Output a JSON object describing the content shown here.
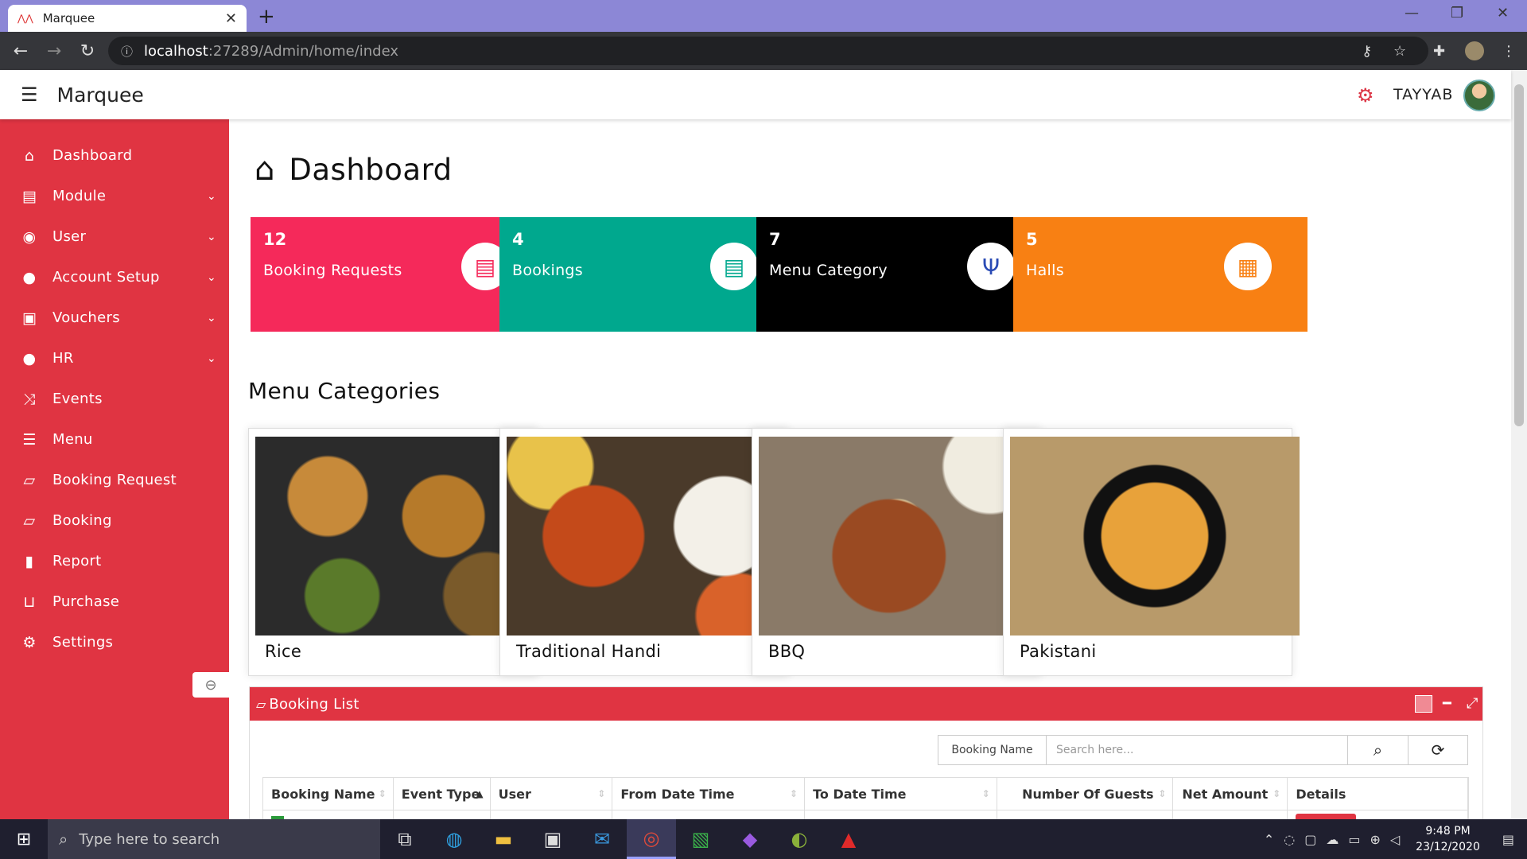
{
  "browser": {
    "tab_title": "Marquee",
    "url_host": "localhost",
    "url_rest": ":27289/Admin/home/index"
  },
  "header": {
    "brand": "Marquee",
    "username": "TAYYAB"
  },
  "sidebar": {
    "items": [
      {
        "label": "Dashboard",
        "icon": "home-icon",
        "glyph": "⌂",
        "expandable": false
      },
      {
        "label": "Module",
        "icon": "archive-icon",
        "glyph": "▤",
        "expandable": true
      },
      {
        "label": "User",
        "icon": "user-circle-icon",
        "glyph": "◉",
        "expandable": true
      },
      {
        "label": "Account Setup",
        "icon": "user-icon",
        "glyph": "●",
        "expandable": true
      },
      {
        "label": "Vouchers",
        "icon": "money-icon",
        "glyph": "▣",
        "expandable": true
      },
      {
        "label": "HR",
        "icon": "user-icon",
        "glyph": "●",
        "expandable": true
      },
      {
        "label": "Events",
        "icon": "random-icon",
        "glyph": "⤨",
        "expandable": false
      },
      {
        "label": "Menu",
        "icon": "list-icon",
        "glyph": "☰",
        "expandable": false
      },
      {
        "label": "Booking Request",
        "icon": "book-icon",
        "glyph": "▱",
        "expandable": false
      },
      {
        "label": "Booking",
        "icon": "book-icon",
        "glyph": "▱",
        "expandable": false
      },
      {
        "label": "Report",
        "icon": "file-icon",
        "glyph": "▮",
        "expandable": false
      },
      {
        "label": "Purchase",
        "icon": "cart-icon",
        "glyph": "⊔",
        "expandable": false
      },
      {
        "label": "Settings",
        "icon": "cogs-icon",
        "glyph": "⚙",
        "expandable": false
      }
    ]
  },
  "page": {
    "title": "Dashboard"
  },
  "cards": [
    {
      "count": "12",
      "label": "Booking Requests",
      "color": "#f5295a",
      "icon": "book-icon",
      "icon_color": "#f5295a"
    },
    {
      "count": "4",
      "label": "Bookings",
      "color": "#00a88e",
      "icon": "book-icon",
      "icon_color": "#00a88e"
    },
    {
      "count": "7",
      "label": "Menu Category",
      "color": "#000000",
      "icon": "utensils-icon",
      "icon_color": "#2a4bb5"
    },
    {
      "count": "5",
      "label": "Halls",
      "color": "#f88013",
      "icon": "building-icon",
      "icon_color": "#f88013"
    }
  ],
  "menu_categories": {
    "title": "Menu Categories",
    "items": [
      {
        "name": "Rice"
      },
      {
        "name": "Traditional Handi"
      },
      {
        "name": "BBQ"
      },
      {
        "name": "Pakistani"
      }
    ]
  },
  "booking_list": {
    "title": "Booking List",
    "search_field": "Booking Name",
    "search_placeholder": "Search here...",
    "columns": [
      "Booking Name",
      "Event Type",
      "User",
      "From Date Time",
      "To Date Time",
      "Number Of Guests",
      "Net Amount",
      "Details"
    ]
  },
  "taskbar": {
    "search_placeholder": "Type here to search",
    "time": "9:48 PM",
    "date": "23/12/2020"
  },
  "colors": {
    "sidebar": "#e03442",
    "accent": "#dc3545"
  }
}
